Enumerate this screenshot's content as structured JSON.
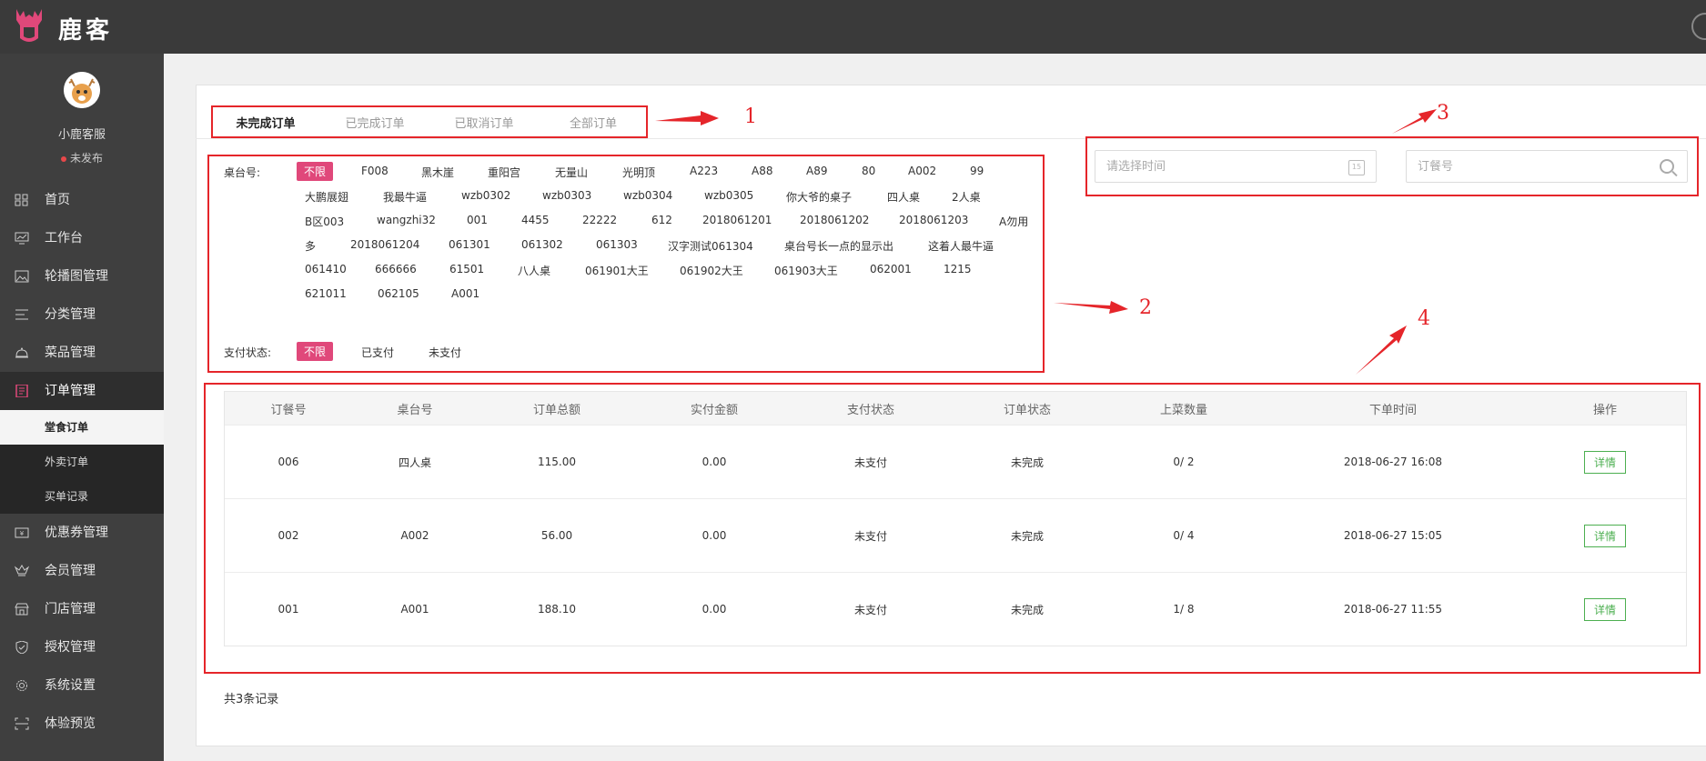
{
  "brand": {
    "name": "鹿客"
  },
  "user": {
    "name": "小鹿客服",
    "status": "未发布"
  },
  "nav": [
    {
      "label": "首页",
      "icon": "grid-icon"
    },
    {
      "label": "工作台",
      "icon": "monitor-icon"
    },
    {
      "label": "轮播图管理",
      "icon": "image-icon"
    },
    {
      "label": "分类管理",
      "icon": "list-icon"
    },
    {
      "label": "菜品管理",
      "icon": "dish-icon"
    },
    {
      "label": "订单管理",
      "icon": "order-icon",
      "active": true
    }
  ],
  "subnav": [
    {
      "label": "堂食订单",
      "active": true
    },
    {
      "label": "外卖订单"
    },
    {
      "label": "买单记录"
    }
  ],
  "nav2": [
    {
      "label": "优惠券管理",
      "icon": "coupon-icon"
    },
    {
      "label": "会员管理",
      "icon": "crown-icon"
    },
    {
      "label": "门店管理",
      "icon": "store-icon"
    },
    {
      "label": "授权管理",
      "icon": "shield-icon"
    },
    {
      "label": "系统设置",
      "icon": "gear-icon"
    },
    {
      "label": "体验预览",
      "icon": "scan-icon"
    }
  ],
  "tabs": [
    "未完成订单",
    "已完成订单",
    "已取消订单",
    "全部订单"
  ],
  "annotations": [
    "1",
    "2",
    "3",
    "4"
  ],
  "filters": {
    "table_label": "桌台号:",
    "tables": [
      [
        "不限",
        "F008",
        "黑木崖",
        "重阳宫",
        "无量山",
        "光明顶",
        "A223",
        "A88",
        "A89",
        "80",
        "A002",
        "99"
      ],
      [
        "大鹏展翅",
        "我最牛逼",
        "wzb0302",
        "wzb0303",
        "wzb0304",
        "wzb0305",
        "你大爷的桌子",
        "四人桌",
        "2人桌"
      ],
      [
        "B区003",
        "wangzhi32",
        "001",
        "4455",
        "22222",
        "612",
        "2018061201",
        "2018061202",
        "2018061203",
        "A勿用"
      ],
      [
        "多",
        "2018061204",
        "061301",
        "061302",
        "061303",
        "汉字测试061304",
        "桌台号长一点的显示出",
        "这着人最牛逼"
      ],
      [
        "061410",
        "666666",
        "61501",
        "八人桌",
        "061901大王",
        "061902大王",
        "061903大王",
        "062001",
        "1215"
      ],
      [
        "621011",
        "062105",
        "A001"
      ]
    ],
    "pay_label": "支付状态:",
    "pay": [
      "不限",
      "已支付",
      "未支付"
    ]
  },
  "search": {
    "time_placeholder": "请选择时间",
    "order_placeholder": "订餐号",
    "calendar_text": "15"
  },
  "table": {
    "headers": [
      "订餐号",
      "桌台号",
      "订单总额",
      "实付金额",
      "支付状态",
      "订单状态",
      "上菜数量",
      "下单时间",
      "操作"
    ],
    "rows": [
      [
        "006",
        "四人桌",
        "115.00",
        "0.00",
        "未支付",
        "未完成",
        "0/ 2",
        "2018-06-27 16:08"
      ],
      [
        "002",
        "A002",
        "56.00",
        "0.00",
        "未支付",
        "未完成",
        "0/ 4",
        "2018-06-27 15:05"
      ],
      [
        "001",
        "A001",
        "188.10",
        "0.00",
        "未支付",
        "未完成",
        "1/ 8",
        "2018-06-27 11:55"
      ]
    ],
    "action_label": "详情"
  },
  "total": "共3条记录",
  "colors": {
    "accent": "#e0487a",
    "annotation": "#e5252a",
    "detail": "#4caf50"
  }
}
